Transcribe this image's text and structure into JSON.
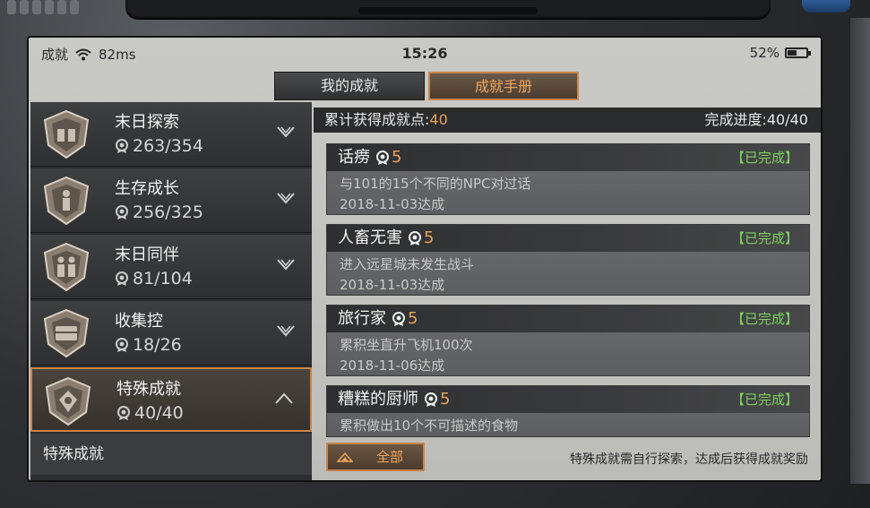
{
  "status": {
    "carrier": "成就",
    "ping": "82ms",
    "time": "15:26",
    "battery": "52%",
    "battery_level": 0.52
  },
  "tabs": [
    {
      "label": "我的成就",
      "active": false
    },
    {
      "label": "成就手册",
      "active": true
    }
  ],
  "categories": [
    {
      "title": "末日探索",
      "points": "263/354",
      "expanded": false
    },
    {
      "title": "生存成长",
      "points": "256/325",
      "expanded": false
    },
    {
      "title": "末日同伴",
      "points": "81/104",
      "expanded": false
    },
    {
      "title": "收集控",
      "points": "18/26",
      "expanded": false
    },
    {
      "title": "特殊成就",
      "points": "40/40",
      "expanded": true
    }
  ],
  "subitem": "特殊成就",
  "summary": {
    "label": "累计获得成就点:",
    "value": "40",
    "progress": "完成进度:40/40"
  },
  "achievements": [
    {
      "name": "话痨",
      "points": "5",
      "status": "【已完成】",
      "desc": "与101的15个不同的NPC对过话",
      "date": "2018-11-03达成"
    },
    {
      "name": "人畜无害",
      "points": "5",
      "status": "【已完成】",
      "desc": "进入远星城未发生战斗",
      "date": "2018-11-03达成"
    },
    {
      "name": "旅行家",
      "points": "5",
      "status": "【已完成】",
      "desc": "累积坐直升飞机100次",
      "date": "2018-11-06达成"
    },
    {
      "name": "糟糕的厨师",
      "points": "5",
      "status": "【已完成】",
      "desc": "累积做出10个不可描述的食物",
      "date": ""
    }
  ],
  "all_button": "全部",
  "hint": "特殊成就需自行探索，达成后获得成就奖励",
  "colors": {
    "accent": "#c9854a",
    "highlight": "#e9a35b",
    "done": "#7ed15e"
  },
  "icons": {
    "wifi": "wifi-icon",
    "battery": "battery-icon",
    "chevron": "chevron-down-icon",
    "points": "medal-icon"
  }
}
